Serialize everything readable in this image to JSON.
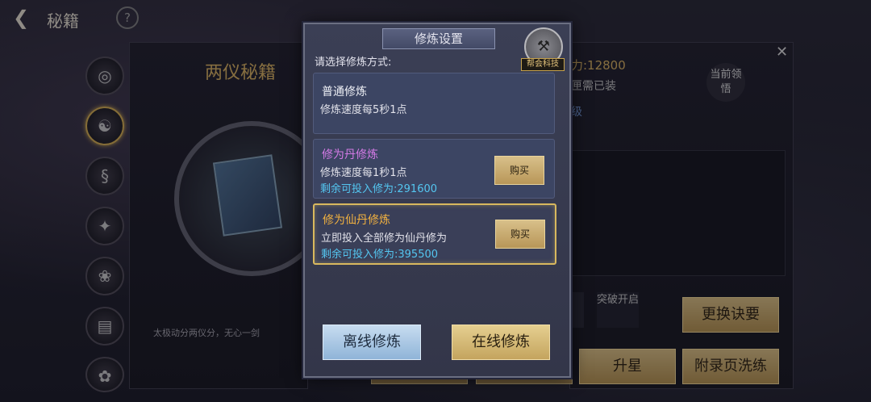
{
  "header": {
    "title": "秘籍",
    "help": "?"
  },
  "book": {
    "name": "两仪秘籍",
    "quote": "太极动分两仪分，无心一剑"
  },
  "right": {
    "power": "力:12800",
    "equipped": "匣需已装",
    "level": "级",
    "current_label": "当前领悟",
    "break_label": "突破开启",
    "replace_button": "更换诀要",
    "star_button": "升星",
    "appendix_button": "附录页洗练"
  },
  "dialog": {
    "title": "修炼设置",
    "guild_label": "帮会科技",
    "prompt": "请选择修炼方式:",
    "options": [
      {
        "name": "普通修炼",
        "desc": "修炼速度每5秒1点",
        "remain": "",
        "buy": ""
      },
      {
        "name": "修为丹修炼",
        "desc": "修炼速度每1秒1点",
        "remain": "剩余可投入修为:291600",
        "buy": "购买"
      },
      {
        "name": "修为仙丹修炼",
        "desc": "立即投入全部修为仙丹修为",
        "remain": "剩余可投入修为:395500",
        "buy": "购买"
      }
    ],
    "offline_button": "离线修炼",
    "online_button": "在线修炼"
  },
  "colors": {
    "gold": "#d8b85e",
    "cyan": "#54c6f0",
    "purple": "#d47ae6",
    "orange": "#f0b040"
  }
}
